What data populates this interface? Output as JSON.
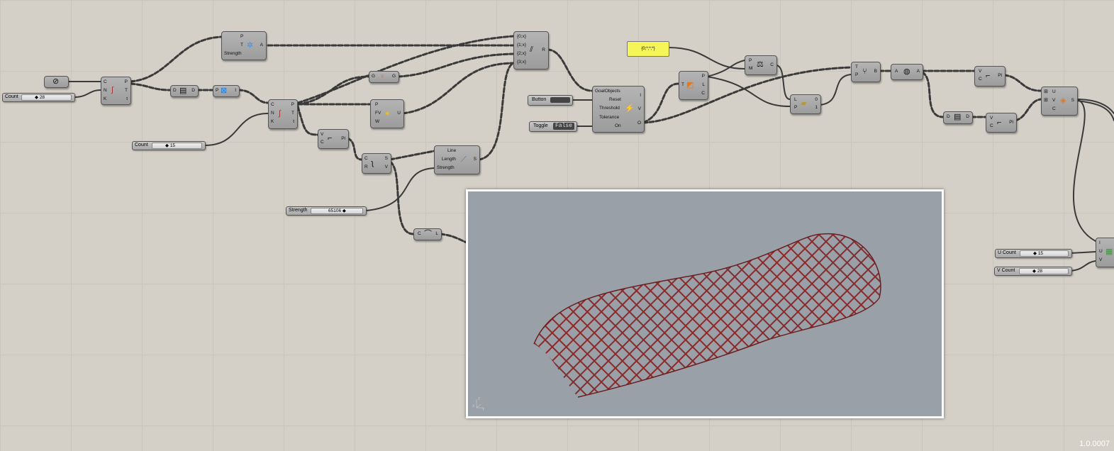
{
  "sliders": {
    "count_top": {
      "label": "Count",
      "value": "28"
    },
    "count_mid": {
      "label": "Count",
      "value": "15"
    },
    "strength": {
      "label": "Strength",
      "value": "65106"
    },
    "u_count": {
      "label": "U Count",
      "value": "15"
    },
    "v_count": {
      "label": "V Count",
      "value": "28"
    }
  },
  "buttons": {
    "button": {
      "label": "Button"
    },
    "toggle": {
      "label": "Toggle",
      "value": "False"
    }
  },
  "panel": {
    "text": "{0;*;*;*}"
  },
  "comps": {
    "anchor": {
      "pins_in": [
        "P",
        "T",
        "Strength"
      ],
      "pins_out": [
        "A"
      ]
    },
    "divide_curve_1": {
      "pins_in": [
        "C",
        "N",
        "K"
      ],
      "pins_out": [
        "P",
        "T",
        "t"
      ]
    },
    "divide_curve_2": {
      "pins_in": [
        "C",
        "N",
        "K"
      ],
      "pins_out": [
        "P",
        "T",
        "t"
      ]
    },
    "data_1": {
      "pins_in": [
        "D"
      ],
      "pins_out": [
        "D"
      ]
    },
    "pt": {
      "pins_in": [
        "P"
      ],
      "pins_out": [
        "I"
      ]
    },
    "graph": {
      "pins_in": [
        "G"
      ],
      "pins_out": [
        "G"
      ]
    },
    "load": {
      "pins_in": [
        "P",
        "FV",
        "W"
      ],
      "pins_out": [
        "U"
      ]
    },
    "vpl_1": {
      "pins_in": [
        "V",
        "C"
      ],
      "pins_out": [
        "Pl"
      ]
    },
    "shatter": {
      "pins_in": [
        "C",
        "R"
      ],
      "pins_out": [
        "S",
        "V"
      ]
    },
    "length": {
      "pins_in": [
        "Line",
        "Length",
        "Strength"
      ],
      "pins_out": [
        "S"
      ]
    },
    "curve_len": {
      "pins_in": [
        "C"
      ],
      "pins_out": [
        "L"
      ]
    },
    "merge": {
      "pins_in": [
        "{0;x}",
        "{1;x}",
        "{2;x}",
        "{3;x}"
      ],
      "pins_out": [
        "R"
      ]
    },
    "solver": {
      "pins_in": [
        "GoalObjects",
        "Reset",
        "Threshold",
        "Tolerance",
        "On"
      ],
      "pins_out": [
        "I",
        "V",
        "O"
      ]
    },
    "tree": {
      "pins_in": [
        "T"
      ],
      "pins_out": [
        "P",
        "L",
        "C"
      ]
    },
    "match": {
      "pins_in": [
        "P",
        "M"
      ],
      "pins_out": [
        "C"
      ]
    },
    "list": {
      "pins_in": [
        "L",
        "P"
      ],
      "pins_out": [
        "0",
        "1"
      ]
    },
    "tree_branch": {
      "pins_in": [
        "T",
        "P"
      ],
      "pins_out": [
        "B"
      ]
    },
    "flip": {
      "pins_in": [
        "A"
      ],
      "pins_out": [
        "A"
      ]
    },
    "vpl_2": {
      "pins_in": [
        "V",
        "C"
      ],
      "pins_out": [
        "Pl"
      ]
    },
    "data_2": {
      "pins_in": [
        "D"
      ],
      "pins_out": [
        "D"
      ]
    },
    "vpl_3": {
      "pins_in": [
        "V",
        "C"
      ],
      "pins_out": [
        "Pl"
      ]
    },
    "loft": {
      "pins_in": [
        "U",
        "V",
        "C"
      ],
      "pins_out": [
        "S"
      ]
    },
    "surface": {
      "pins_in": [
        "I",
        "U",
        "V"
      ],
      "pins_out": []
    }
  },
  "viewport": {
    "axis_labels": [
      "Z",
      "X",
      "Y"
    ]
  },
  "version": "1.0.0007"
}
